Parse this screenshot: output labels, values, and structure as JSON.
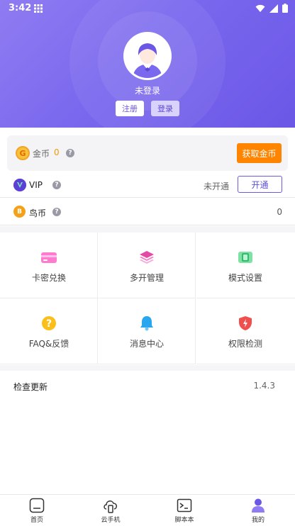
{
  "status_bar": {
    "time": "3:42"
  },
  "profile": {
    "status_text": "未登录",
    "register_label": "注册",
    "login_label": "登录"
  },
  "coins": {
    "icon_letter": "G",
    "label": "金币",
    "value": "0",
    "get_button": "获取金币"
  },
  "vip": {
    "label": "VIP",
    "status": "未开通",
    "open_button": "开通"
  },
  "bird_coin": {
    "icon_letter": "B",
    "label": "鸟币",
    "value": "0"
  },
  "features": [
    {
      "label": "卡密兑换",
      "icon": "card-icon"
    },
    {
      "label": "多开管理",
      "icon": "layers-icon"
    },
    {
      "label": "模式设置",
      "icon": "mode-icon"
    },
    {
      "label": "FAQ&反馈",
      "icon": "question-icon"
    },
    {
      "label": "消息中心",
      "icon": "bell-icon"
    },
    {
      "label": "权限检测",
      "icon": "shield-icon"
    }
  ],
  "update": {
    "label": "检查更新",
    "version": "1.4.3"
  },
  "tabs": [
    {
      "label": "首页",
      "icon": "home-icon"
    },
    {
      "label": "云手机",
      "icon": "cloud-phone-icon"
    },
    {
      "label": "脚本本",
      "icon": "terminal-icon"
    },
    {
      "label": "我的",
      "icon": "profile-icon"
    }
  ],
  "colors": {
    "header_gradient_start": "#8f7cf2",
    "header_gradient_end": "#6b57e6",
    "accent_orange": "#ff8500",
    "vip_purple": "#5b3fd6"
  }
}
